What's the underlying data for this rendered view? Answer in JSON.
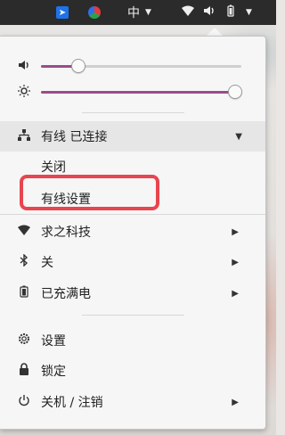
{
  "topbar": {
    "ime_label": "中",
    "icons": [
      "app-launcher-icon",
      "color-app-icon",
      "wifi-icon",
      "volume-icon",
      "battery-icon",
      "caret-down-icon"
    ]
  },
  "menu": {
    "volume": {
      "level": 0.18,
      "icon": "speaker-icon"
    },
    "brightness": {
      "level": 1.0,
      "icon": "sun-icon"
    },
    "wired": {
      "label": "有线 已连接",
      "expanded": true,
      "submenu": [
        "关闭",
        "有线设置"
      ]
    },
    "wifi": {
      "label": "求之科技"
    },
    "bluetooth": {
      "label": "关"
    },
    "battery": {
      "label": "已充满电"
    },
    "settings": {
      "label": "设置"
    },
    "lock": {
      "label": "锁定"
    },
    "power": {
      "label": "关机 / 注销"
    }
  },
  "colors": {
    "accent": "#9a4c8a",
    "highlight": "#e8454f",
    "topbar": "#2b2b2b"
  }
}
